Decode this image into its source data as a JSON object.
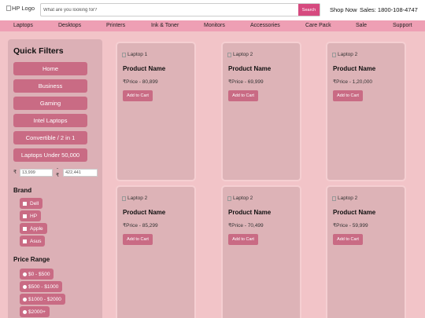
{
  "header": {
    "logo_alt": "HP Logo",
    "search_placeholder": "What are you looking for?",
    "search_button": "Search",
    "shop_now": "Shop Now",
    "sales": "Sales: 1800-108-4747"
  },
  "nav": {
    "items": [
      "Laptops",
      "Desktops",
      "Printers",
      "Ink & Toner",
      "Monitors",
      "Accessories",
      "Care Pack",
      "Sale",
      "Support"
    ]
  },
  "sidebar": {
    "title": "Quick Filters",
    "filters": [
      "Home",
      "Business",
      "Gaming",
      "Intel Laptops",
      "Convertible / 2 in 1",
      "Laptops Under 50,000"
    ],
    "range": {
      "currency": "₹",
      "dash": "-",
      "min": "13,999",
      "max": "422,441"
    },
    "brand_title": "Brand",
    "brands": [
      "Dell",
      "HP",
      "Apple",
      "Asus"
    ],
    "price_title": "Price Range",
    "price_ranges": [
      "$0 - $500",
      "$500 - $1000",
      "$1000 - $2000",
      "$2000+"
    ]
  },
  "products": [
    {
      "image_alt": "Laptop 1",
      "name": "Product Name",
      "price": "₹Price - 80,899",
      "button": "Add to Cart"
    },
    {
      "image_alt": "Laptop 2",
      "name": "Product Name",
      "price": "₹Price - 69,999",
      "button": "Add to Cart"
    },
    {
      "image_alt": "Laptop 2",
      "name": "Product Name",
      "price": "₹Price - 1,20,000",
      "button": "Add to Cart"
    },
    {
      "image_alt": "Laptop 2",
      "name": "Product Name",
      "price": "₹Price - 85,299",
      "button": "Add to Cart"
    },
    {
      "image_alt": "Laptop 2",
      "name": "Product Name",
      "price": "₹Price - 70,499",
      "button": "Add to Cart"
    },
    {
      "image_alt": "Laptop 2",
      "name": "Product Name",
      "price": "₹Price - 59,999",
      "button": "Add to Cart"
    }
  ],
  "colors": {
    "accent": "#d64a7f",
    "nav_bg": "#ee9fb4",
    "page_bg": "#f2c4c8",
    "button": "#c96b84"
  }
}
